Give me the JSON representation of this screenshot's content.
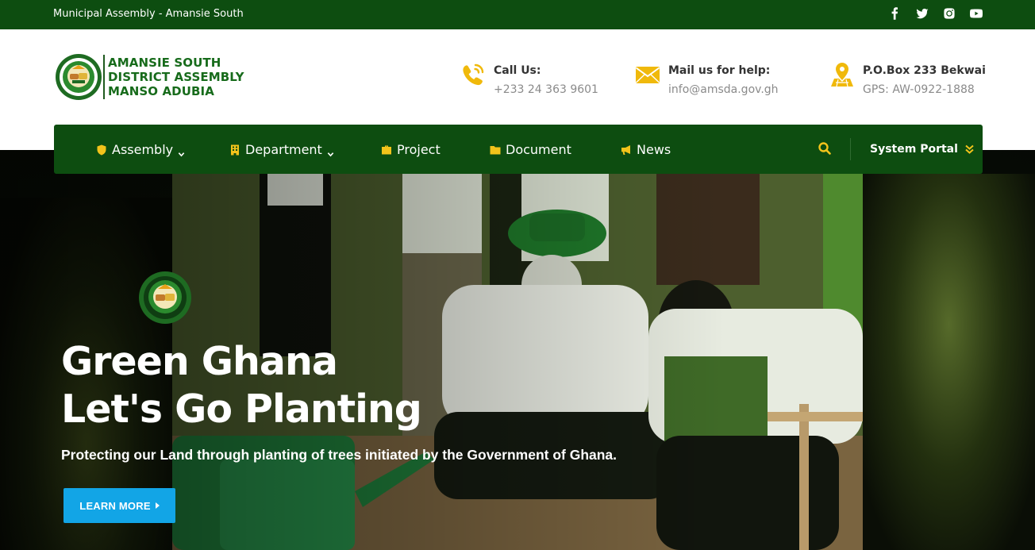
{
  "topbar": {
    "tagline": "Municipal Assembly - Amansie South",
    "social": [
      "facebook-icon",
      "twitter-icon",
      "instagram-icon",
      "youtube-icon"
    ]
  },
  "brand": {
    "line1": "AMANSIE SOUTH",
    "line2": "DISTRICT ASSEMBLY",
    "line3": "MANSO ADUBIA",
    "color": "#176b1b"
  },
  "contacts": {
    "call": {
      "label": "Call Us:",
      "value": "+233 24 363 9601",
      "icon": "phone-icon"
    },
    "mail": {
      "label": "Mail us for help:",
      "value": "info@amsda.gov.gh",
      "icon": "envelope-icon"
    },
    "address": {
      "label": "P.O.Box 233 Bekwai",
      "value": "GPS: AW-0922-1888",
      "icon": "map-pin-icon"
    }
  },
  "nav": {
    "items": [
      {
        "label": "Assembly",
        "icon": "shield-icon",
        "dropdown": true
      },
      {
        "label": "Department",
        "icon": "building-icon",
        "dropdown": true
      },
      {
        "label": "Project",
        "icon": "briefcase-icon",
        "dropdown": false
      },
      {
        "label": "Document",
        "icon": "folder-icon",
        "dropdown": false
      },
      {
        "label": "News",
        "icon": "megaphone-icon",
        "dropdown": false
      }
    ],
    "portal_label": "System Portal",
    "background": "#0d4d10",
    "accent": "#f2c31b"
  },
  "hero": {
    "title_line1": "Green Ghana",
    "title_line2": "Let's Go Planting",
    "subtitle": "Protecting our Land through planting of trees initiated by the Government of Ghana.",
    "button_label": "LEARN MORE",
    "button_color": "#12a5e6"
  }
}
